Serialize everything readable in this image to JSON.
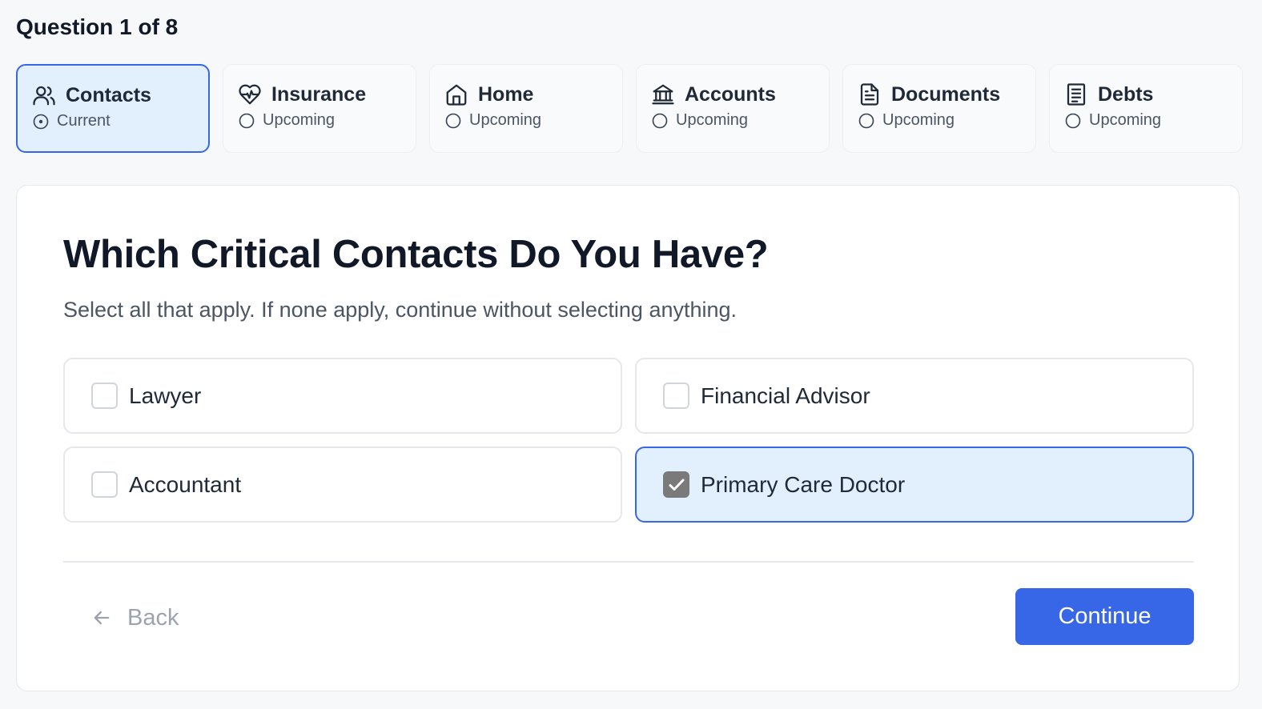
{
  "progress": {
    "label": "Question 1 of 8"
  },
  "steps": [
    {
      "title": "Contacts",
      "status": "Current",
      "icon": "users-icon"
    },
    {
      "title": "Insurance",
      "status": "Upcoming",
      "icon": "heart-pulse-icon"
    },
    {
      "title": "Home",
      "status": "Upcoming",
      "icon": "home-icon"
    },
    {
      "title": "Accounts",
      "status": "Upcoming",
      "icon": "bank-icon"
    },
    {
      "title": "Documents",
      "status": "Upcoming",
      "icon": "document-icon"
    },
    {
      "title": "Debts",
      "status": "Upcoming",
      "icon": "receipt-icon"
    }
  ],
  "question": {
    "title": "Which Critical Contacts Do You Have?",
    "subtitle": "Select all that apply. If none apply, continue without selecting anything."
  },
  "options": [
    {
      "label": "Lawyer",
      "checked": false
    },
    {
      "label": "Financial Advisor",
      "checked": false
    },
    {
      "label": "Accountant",
      "checked": false
    },
    {
      "label": "Primary Care Doctor",
      "checked": true
    }
  ],
  "nav": {
    "back_label": "Back",
    "continue_label": "Continue"
  },
  "colors": {
    "accent": "#3767e6",
    "selected_bg": "#e2effc",
    "page_bg": "#f7f8fa"
  }
}
